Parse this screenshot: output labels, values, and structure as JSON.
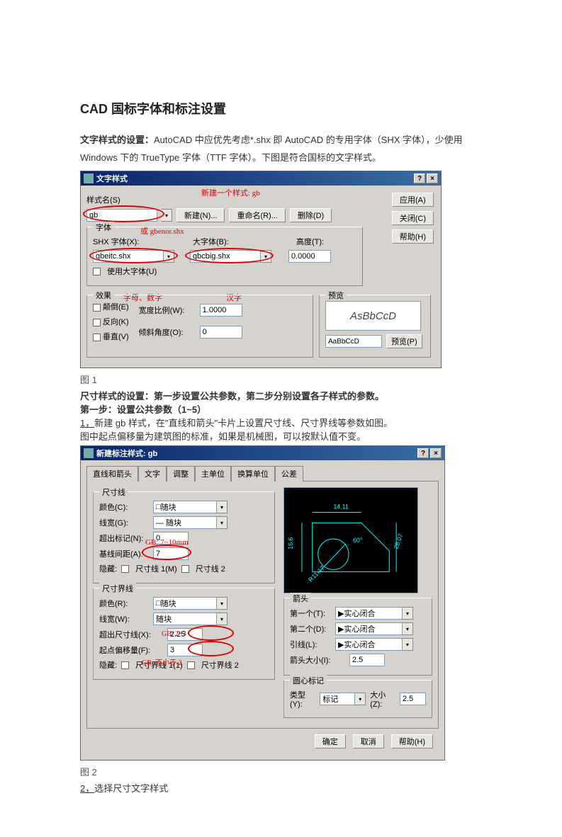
{
  "title": "CAD 国标字体和标注设置",
  "intro": {
    "lead": "文字样式的设置：",
    "body1": "AutoCAD 中应优先考虑*.shx 即 AutoCAD 的专用字体（SHX 字体），少使用 Windows 下的 TrueType 字体（TTF 字体）。下图是符合国标的文字样式。"
  },
  "dialog1": {
    "title": "文字样式",
    "styleNameLabel": "样式名(S)",
    "styleName": "gb",
    "annotNew": "新建一个样式: gb",
    "btnNew": "新建(N)...",
    "btnRename": "重命名(R)...",
    "btnDelete": "删除(D)",
    "btnApply": "应用(A)",
    "btnClose": "关闭(C)",
    "btnHelp": "帮助(H)",
    "fontGroup": "字体",
    "shxFontLabel": "SHX 字体(X):",
    "shxFont": "gbeitc.shx",
    "bigFontLabel": "大字体(B):",
    "bigFont": "gbcbig.shx",
    "heightLabel": "高度(T):",
    "height": "0.0000",
    "useBigFont": "使用大字体(U)",
    "annotOr": "或 gbenor.shx",
    "annotAlpha": "字母、数字",
    "annotHanzi": "汉字",
    "effectGroup": "效果",
    "upside": "颠倒(E)",
    "reverse": "反向(K)",
    "vertical": "垂直(V)",
    "widthLabel": "宽度比例(W):",
    "width": "1.0000",
    "obliqueLabel": "倾斜角度(O):",
    "oblique": "0",
    "previewGroup": "预览",
    "previewText": "AsBbCcD",
    "previewSmall": "AaBbCcD",
    "btnPreview": "预览(P)"
  },
  "cap1": "图 1",
  "mid": {
    "line1": "尺寸样式的设置：第一步设置公共参数，第二步分别设置各子样式的参数。",
    "line2": "第一步：设置公共参数（1~5）",
    "line3u": "1，",
    "line3a": "新建 gb 样式，在\"直线和箭头\"卡片上设置尺寸线、尺寸界线等参数如图。",
    "line4": "图中起点偏移量为建筑图的标准，如果是机械图，可以按默认值不变。"
  },
  "dialog2": {
    "title": "新建标注样式: gb",
    "tabs": [
      "直线和箭头",
      "文字",
      "调整",
      "主单位",
      "换算单位",
      "公差"
    ],
    "dimLineGroup": "尺寸线",
    "colorLabel": "颜色(C):",
    "byblock": "随块",
    "lwLabel": "线宽(G):",
    "lwVal": "— 随块",
    "extBeyondLabel": "超出标记(N):",
    "extBeyond": "0",
    "baselineLabel": "基线间距(A):",
    "baseline": "7",
    "annotBaseline": "GB: 7~10mm",
    "suppressLabel": "隐藏:",
    "supp1": "尺寸线 1(M)",
    "supp2": "尺寸线 2",
    "extLineGroup": "尺寸界线",
    "extColorLabel": "颜色(R):",
    "extLwLabel": "线宽(W):",
    "extLwVal": "随块",
    "extBeyond2Label": "超出尺寸线(X):",
    "extBeyond2": "2.25",
    "annotExt": "GB: 2~3",
    "offsetLabel": "起点偏移量(F):",
    "offset": "3",
    "annotOffset": "GB: 不小于 2",
    "suppExt1": "尺寸界线 1(1)",
    "suppExt2": "尺寸界线 2",
    "arrowGroup": "箭头",
    "arrow1Label": "第一个(T):",
    "arrow1": "实心闭合",
    "arrow2Label": "第二个(D):",
    "arrow2": "实心闭合",
    "leaderLabel": "引线(L):",
    "leader": "实心闭合",
    "arrowSizeLabel": "箭头大小(I):",
    "arrowSize": "2.5",
    "centerGroup": "圆心标记",
    "centerTypeLabel": "类型(Y):",
    "centerType": "标记",
    "centerSizeLabel": "大小(Z):",
    "centerSize": "2.5",
    "previewDims": {
      "w": "14.11",
      "h": "16.6",
      "diag": "28.07",
      "r": "R11.17",
      "ang": "60°"
    },
    "btnOk": "确定",
    "btnCancel": "取消",
    "btnHelp": "帮助(H)"
  },
  "cap2": "图 2",
  "line5": "2，",
  "line5b": "选择尺寸文字样式"
}
